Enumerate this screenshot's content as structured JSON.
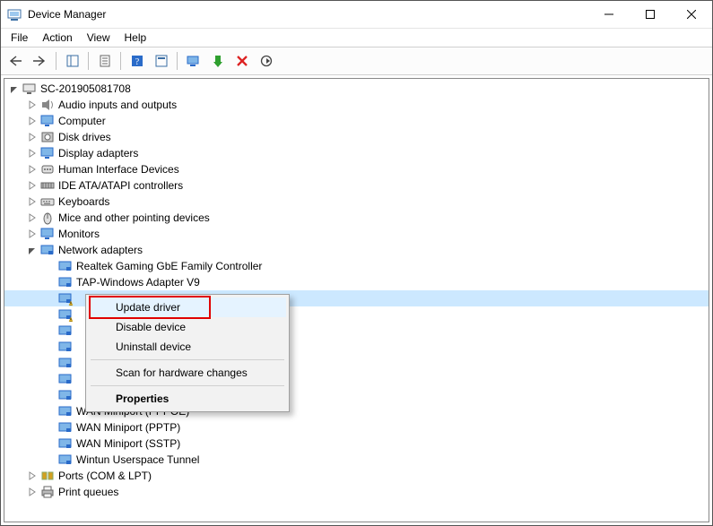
{
  "window": {
    "title": "Device Manager"
  },
  "menu": {
    "items": [
      "File",
      "Action",
      "View",
      "Help"
    ]
  },
  "root": {
    "label": "SC-201905081708",
    "icon": "computer"
  },
  "categories": [
    {
      "label": "Audio inputs and outputs",
      "icon": "audio"
    },
    {
      "label": "Computer",
      "icon": "monitor"
    },
    {
      "label": "Disk drives",
      "icon": "disk"
    },
    {
      "label": "Display adapters",
      "icon": "monitor"
    },
    {
      "label": "Human Interface Devices",
      "icon": "hid"
    },
    {
      "label": "IDE ATA/ATAPI controllers",
      "icon": "ide"
    },
    {
      "label": "Keyboards",
      "icon": "keyboard"
    },
    {
      "label": "Mice and other pointing devices",
      "icon": "mouse"
    },
    {
      "label": "Monitors",
      "icon": "monitor"
    }
  ],
  "network_cat": {
    "label": "Network adapters",
    "icon": "nic"
  },
  "network_devices": [
    {
      "label": "Realtek Gaming GbE Family Controller",
      "icon": "nic",
      "warn": false,
      "selected": false
    },
    {
      "label": "TAP-Windows Adapter V9",
      "icon": "nic",
      "warn": false,
      "selected": false
    },
    {
      "label": "",
      "icon": "nic",
      "warn": true,
      "selected": true
    },
    {
      "label": "",
      "icon": "nic",
      "warn": true,
      "selected": false
    },
    {
      "label": "",
      "icon": "nic",
      "warn": false,
      "selected": false
    },
    {
      "label": "",
      "icon": "nic",
      "warn": false,
      "selected": false
    },
    {
      "label": "",
      "icon": "nic",
      "warn": false,
      "selected": false
    },
    {
      "label": "",
      "icon": "nic",
      "warn": false,
      "selected": false
    },
    {
      "label": "",
      "icon": "nic",
      "warn": false,
      "selected": false
    },
    {
      "label": "WAN Miniport (PPPOE)",
      "icon": "nic",
      "warn": false,
      "selected": false
    },
    {
      "label": "WAN Miniport (PPTP)",
      "icon": "nic",
      "warn": false,
      "selected": false
    },
    {
      "label": "WAN Miniport (SSTP)",
      "icon": "nic",
      "warn": false,
      "selected": false
    },
    {
      "label": "Wintun Userspace Tunnel",
      "icon": "nic",
      "warn": false,
      "selected": false
    }
  ],
  "tail_categories": [
    {
      "label": "Ports (COM & LPT)",
      "icon": "ports"
    },
    {
      "label": "Print queues",
      "icon": "printer"
    }
  ],
  "context_menu": {
    "items": [
      {
        "label": "Update driver",
        "highlight": true,
        "bold": false
      },
      {
        "label": "Disable device",
        "highlight": false,
        "bold": false
      },
      {
        "label": "Uninstall device",
        "highlight": false,
        "bold": false
      },
      {
        "sep": true
      },
      {
        "label": "Scan for hardware changes",
        "highlight": false,
        "bold": false
      },
      {
        "sep": true
      },
      {
        "label": "Properties",
        "highlight": false,
        "bold": true
      }
    ]
  }
}
